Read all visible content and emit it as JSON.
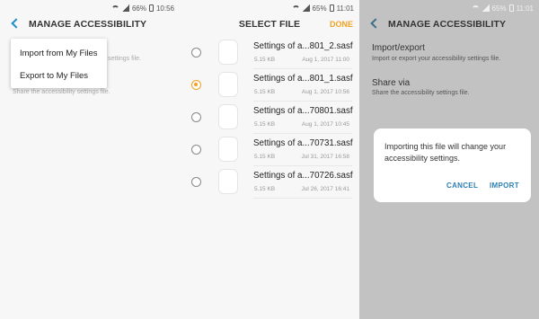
{
  "screen1": {
    "status_time": "10:56",
    "battery": "66%",
    "title": "MANAGE ACCESSIBILITY",
    "menu": [
      "Import from My Files",
      "Export to My Files"
    ],
    "faded_texts": [
      "settings file.",
      "Share the accessibility settings file."
    ]
  },
  "screen2": {
    "status_time": "11:01",
    "battery": "65%",
    "title": "SELECT FILE",
    "done_label": "DONE",
    "files": [
      {
        "name": "Settings of a...801_2.sasf",
        "size": "5.15 KB",
        "date": "Aug 1, 2017 11:00",
        "selected": false
      },
      {
        "name": "Settings of a...801_1.sasf",
        "size": "5.15 KB",
        "date": "Aug 1, 2017 10:56",
        "selected": true
      },
      {
        "name": "Settings of a...70801.sasf",
        "size": "5.15 KB",
        "date": "Aug 1, 2017 10:45",
        "selected": false
      },
      {
        "name": "Settings of a...70731.sasf",
        "size": "5.15 KB",
        "date": "Jul 31, 2017 16:58",
        "selected": false
      },
      {
        "name": "Settings of a...70726.sasf",
        "size": "5.15 KB",
        "date": "Jul 26, 2017 16:41",
        "selected": false
      }
    ]
  },
  "screen3": {
    "status_time": "11:01",
    "battery": "65%",
    "title": "MANAGE ACCESSIBILITY",
    "items": [
      {
        "title": "Import/export",
        "subtitle": "Import or export your accessibility settings file."
      },
      {
        "title": "Share via",
        "subtitle": "Share the accessibility settings file."
      }
    ],
    "dialog": {
      "message": "Importing this file will change your accessibility settings.",
      "cancel_label": "CANCEL",
      "import_label": "IMPORT"
    }
  },
  "colors": {
    "accent_orange": "#f0a322",
    "back_blue": "#1a8fc7",
    "dialog_button_blue": "#2e7fb3",
    "dim_overlay": "#c2c2c2"
  }
}
